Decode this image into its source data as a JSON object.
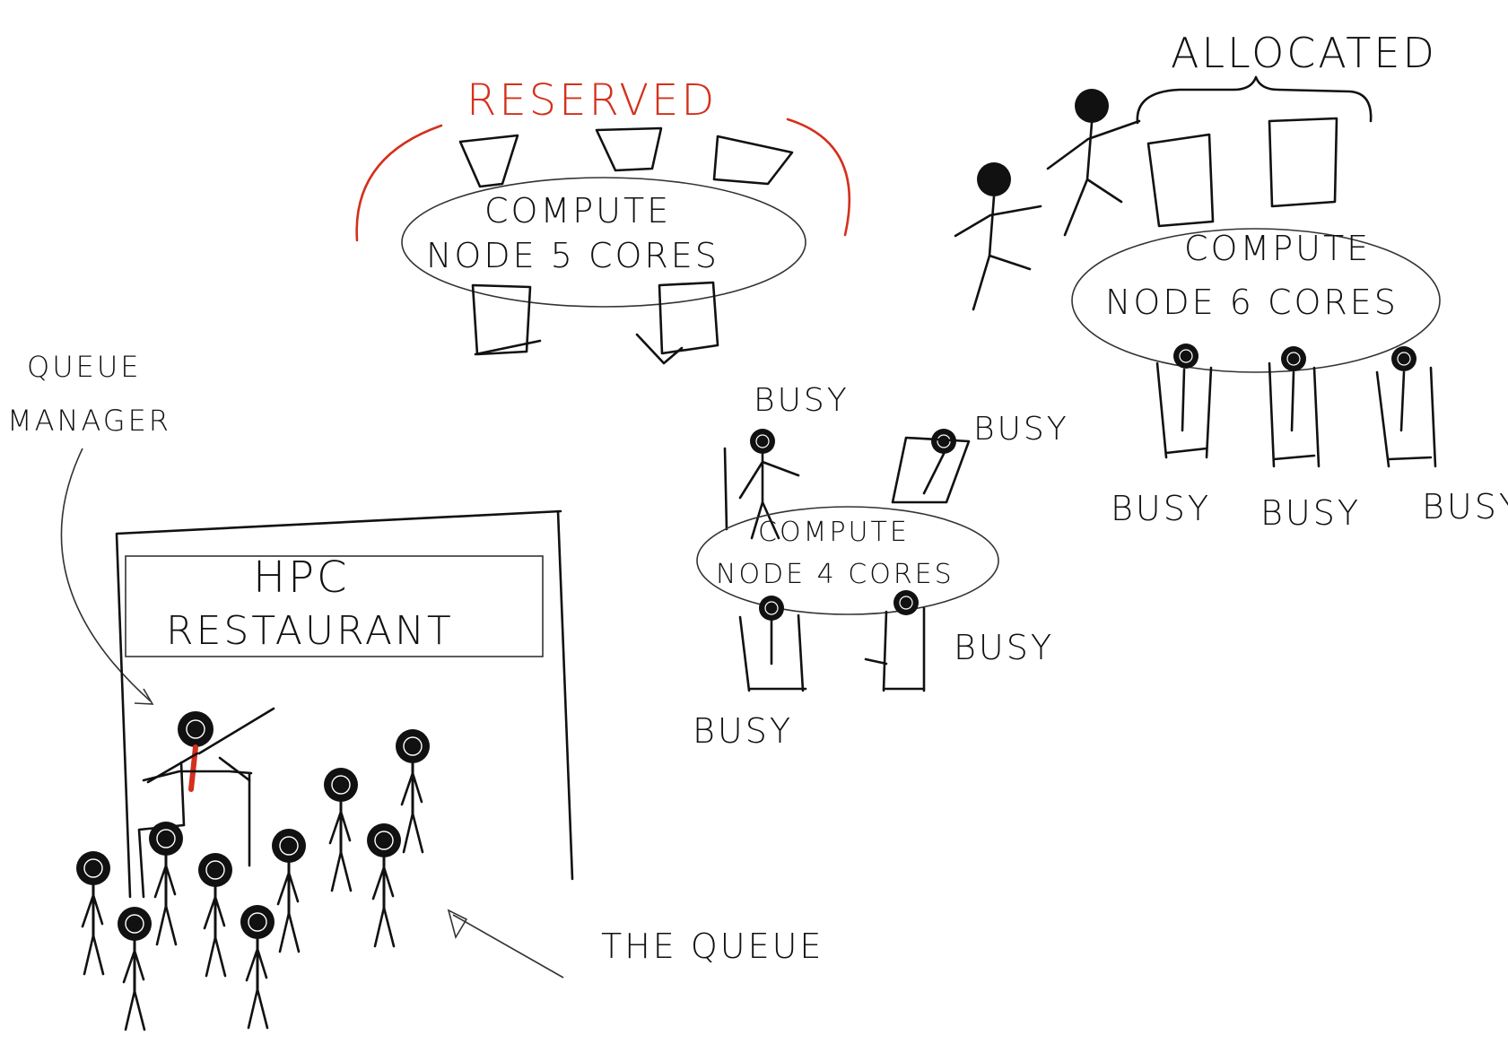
{
  "colors": {
    "ink": "#111111",
    "reserved": "#d4301c",
    "paper": "#ffffff"
  },
  "labels": {
    "reserved": "RESERVED",
    "allocated": "ALLOCATED",
    "queue_manager_line1": "QUEUE",
    "queue_manager_line2": "MANAGER",
    "the_queue": "THE QUEUE",
    "busy": "BUSY"
  },
  "restaurant": {
    "line1": "HPC",
    "line2": "RESTAURANT"
  },
  "nodes": {
    "node5": {
      "line1": "COMPUTE",
      "line2": "NODE   5 CORES"
    },
    "node6": {
      "line1": "COMPUTE",
      "line2": "NODE   6 CORES"
    },
    "node4": {
      "line1": "COMPUTE",
      "line2": "NODE 4 CORES"
    }
  }
}
